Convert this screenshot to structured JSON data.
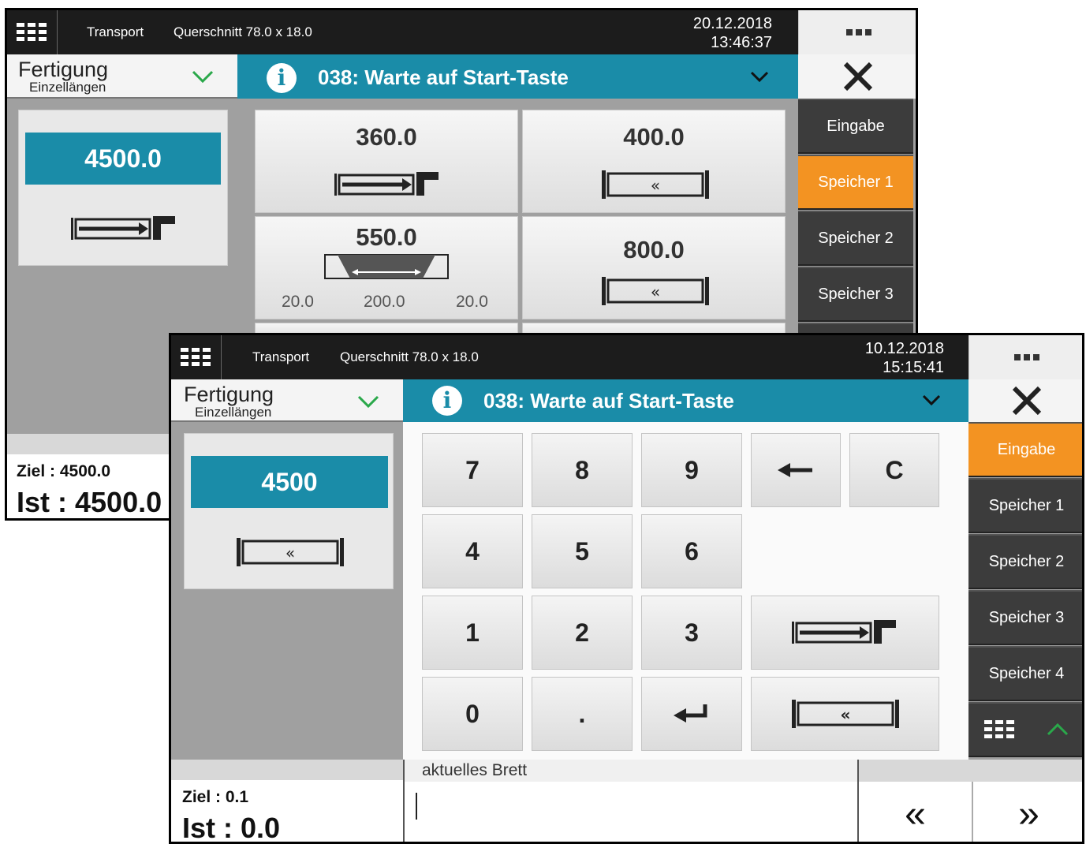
{
  "back_screen": {
    "topbar": {
      "transport": "Transport",
      "querschnitt": "Querschnitt 78.0 x 18.0",
      "date": "20.12.2018",
      "time": "13:46:37"
    },
    "production": {
      "mode": "Fertigung",
      "sub": "Einzellängen"
    },
    "status": "038: Warte auf Start-Taste",
    "target_value": "4500.0",
    "sidebar": [
      "Eingabe",
      "Speicher 1",
      "Speicher 2",
      "Speicher 3"
    ],
    "active_sidebar": "Speicher 1",
    "memory_cells": [
      {
        "value": "360.0",
        "icon": "stop-right-icon"
      },
      {
        "value": "400.0",
        "icon": "rewind-frame-icon"
      },
      {
        "value": "550.0",
        "icon": "trapezoid-cut-icon",
        "left": "20.0",
        "mid": "200.0",
        "right": "20.0"
      },
      {
        "value": "800.0",
        "icon": "rewind-frame-icon"
      }
    ],
    "footer": {
      "ziel": "Ziel : 4500.0",
      "ist": "Ist : 4500.0"
    }
  },
  "front_screen": {
    "topbar": {
      "transport": "Transport",
      "querschnitt": "Querschnitt 78.0 x 18.0",
      "date": "10.12.2018",
      "time": "15:15:41"
    },
    "production": {
      "mode": "Fertigung",
      "sub": "Einzellängen"
    },
    "status": "038: Warte auf Start-Taste",
    "target_value": "4500",
    "keypad": {
      "k7": "7",
      "k8": "8",
      "k9": "9",
      "clear": "C",
      "k4": "4",
      "k5": "5",
      "k6": "6",
      "k1": "1",
      "k2": "2",
      "k3": "3",
      "k0": "0",
      "dot": "."
    },
    "sidebar": [
      "Eingabe",
      "Speicher 1",
      "Speicher 2",
      "Speicher 3",
      "Speicher 4"
    ],
    "active_sidebar": "Eingabe",
    "current_board_label": "aktuelles Brett",
    "footer": {
      "ziel": "Ziel : 0.1",
      "ist": "Ist : 0.0"
    },
    "nav": {
      "prev": "«",
      "next": "»"
    }
  },
  "colors": {
    "accent": "#1a8ca8",
    "active": "#f39322",
    "dark": "#1c1c1c",
    "sidebar": "#3c3c3c"
  }
}
